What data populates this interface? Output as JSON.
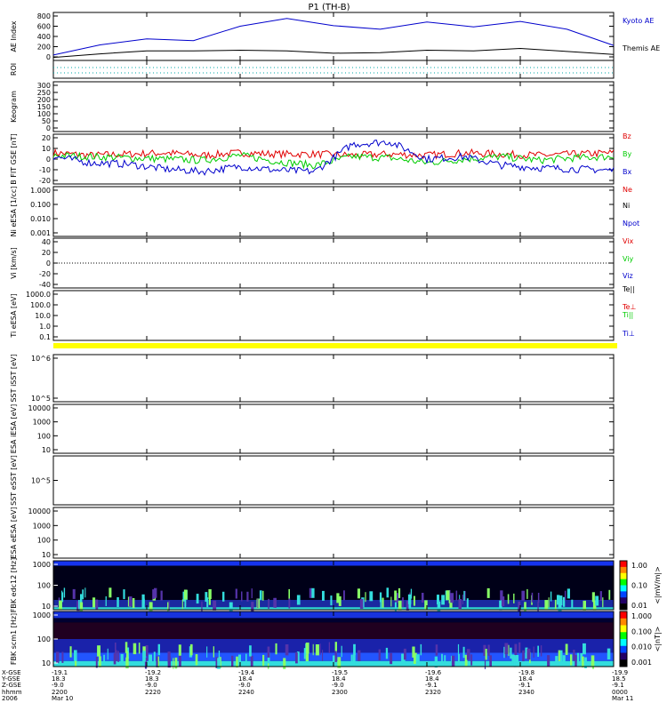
{
  "title": "P1 (TH-B)",
  "colors": {
    "red": "#e00000",
    "green": "#00cc00",
    "blue": "#0000cc",
    "black": "#000000",
    "yellow": "#ffff00",
    "roi": "#00aaaa"
  },
  "colorbars": {
    "fbk1": {
      "ticks": [
        "1.00",
        "0.10",
        "0.01"
      ],
      "label": "<|mV/m|>"
    },
    "fbk2": {
      "ticks": [
        "1.000",
        "0.100",
        "0.010",
        "0.001"
      ],
      "label": "<|nT|>"
    }
  },
  "time_axis": {
    "row_labels": [
      "X-GSE",
      "Y-GSE",
      "Z-GSE",
      "hhmm",
      "2006"
    ],
    "columns": [
      {
        "x": "-19.1",
        "y": "18.3",
        "z": "-9.0",
        "t": "2200",
        "date": "Mar 10"
      },
      {
        "x": "-19.2",
        "y": "18.3",
        "z": "-9.0",
        "t": "2220",
        "date": ""
      },
      {
        "x": "-19.4",
        "y": "18.4",
        "z": "-9.0",
        "t": "2240",
        "date": ""
      },
      {
        "x": "-19.5",
        "y": "18.4",
        "z": "-9.0",
        "t": "2300",
        "date": ""
      },
      {
        "x": "-19.6",
        "y": "18.4",
        "z": "-9.1",
        "t": "2320",
        "date": ""
      },
      {
        "x": "-19.8",
        "y": "18.4",
        "z": "-9.1",
        "t": "2340",
        "date": ""
      },
      {
        "x": "-19.9",
        "y": "18.5",
        "z": "-9.1",
        "t": "0000",
        "date": "Mar 11"
      }
    ]
  },
  "chart_data": [
    {
      "id": "ae",
      "type": "line",
      "ylabel": "AE Index",
      "yticks": [
        "800",
        "600",
        "400",
        "200",
        "0"
      ],
      "ylim": [
        0,
        800
      ],
      "x": [
        "2200",
        "2210",
        "2220",
        "2230",
        "2240",
        "2250",
        "2300",
        "2310",
        "2320",
        "2330",
        "2340",
        "2350",
        "0000"
      ],
      "series": [
        {
          "name": "Kyoto AE",
          "color": "blue",
          "values": [
            90,
            260,
            360,
            330,
            570,
            700,
            580,
            520,
            640,
            560,
            650,
            520,
            250
          ]
        },
        {
          "name": "Themis AE",
          "color": "black",
          "values": [
            50,
            110,
            160,
            160,
            170,
            160,
            120,
            130,
            170,
            160,
            200,
            150,
            100
          ]
        }
      ]
    },
    {
      "id": "roi",
      "type": "line",
      "ylabel": "ROI",
      "yticks": []
    },
    {
      "id": "keo",
      "type": "heatmap",
      "ylabel": "Keogram",
      "yticks": [
        "300",
        "250",
        "200",
        "150",
        "100",
        "50",
        "0"
      ],
      "ylim": [
        0,
        300
      ]
    },
    {
      "id": "bfit",
      "type": "line",
      "ylabel": "B FIT GSE [nT]",
      "yticks": [
        "20",
        "10",
        "0",
        "-10",
        "-20"
      ],
      "ylim": [
        -20,
        20
      ],
      "series": [
        {
          "name": "Bz",
          "color": "red",
          "values": [
            5,
            3,
            4,
            5,
            3,
            5,
            4,
            4,
            3,
            4,
            3,
            5,
            4,
            3,
            4,
            5
          ]
        },
        {
          "name": "By",
          "color": "green",
          "values": [
            3,
            2,
            1,
            0,
            -1,
            3,
            -2,
            -5,
            2,
            1,
            -3,
            0,
            2,
            -1,
            1,
            2
          ]
        },
        {
          "name": "Bx",
          "color": "blue",
          "values": [
            2,
            -3,
            -4,
            -8,
            -10,
            -6,
            -9,
            -10,
            12,
            14,
            0,
            2,
            -5,
            -7,
            -8,
            -9
          ]
        }
      ]
    },
    {
      "id": "ni",
      "type": "line",
      "ylabel": "Ni eESA [1/cc]",
      "yticks": [
        "1.000",
        "0.100",
        "0.010",
        "0.001"
      ],
      "series": [
        {
          "name": "Ne",
          "color": "red"
        },
        {
          "name": "Ni",
          "color": "black"
        },
        {
          "name": "Npot",
          "color": "blue"
        }
      ]
    },
    {
      "id": "vi",
      "type": "line",
      "ylabel": "Vi [km/s]",
      "yticks": [
        "40",
        "20",
        "0",
        "-20",
        "-40"
      ],
      "ylim": [
        -50,
        50
      ],
      "series": [
        {
          "name": "Vix",
          "color": "red"
        },
        {
          "name": "Viy",
          "color": "green"
        },
        {
          "name": "Viz",
          "color": "blue"
        }
      ]
    },
    {
      "id": "ti",
      "type": "line",
      "ylabel": "Ti eESA [eV]",
      "yticks": [
        "1000.0",
        "100.0",
        "10.0",
        "1.0",
        "0.1"
      ],
      "series": [
        {
          "name": "Te||",
          "color": "black"
        },
        {
          "name": "Te⊥",
          "color": "red"
        },
        {
          "name": "Ti||",
          "color": "green"
        },
        {
          "name": "Ti⊥",
          "color": "blue"
        }
      ]
    },
    {
      "id": "sst1",
      "type": "heatmap",
      "ylabel": "SST iSST [eV]",
      "yticks": [
        "10^6",
        "10^5"
      ]
    },
    {
      "id": "esa1",
      "type": "heatmap",
      "ylabel": "ESA iESA [eV]",
      "yticks": [
        "10000",
        "1000",
        "100",
        "10"
      ]
    },
    {
      "id": "sst2",
      "type": "heatmap",
      "ylabel": "SST eSST [eV]",
      "yticks": [
        "10^5"
      ]
    },
    {
      "id": "esa2",
      "type": "heatmap",
      "ylabel": "ESA eESA [eV]",
      "yticks": [
        "10000",
        "1000",
        "100",
        "10"
      ]
    },
    {
      "id": "fbk1",
      "type": "heatmap",
      "ylabel": "FBK edc12 [Hz]",
      "yticks": [
        "1000",
        "100",
        "10"
      ]
    },
    {
      "id": "fbk2",
      "type": "heatmap",
      "ylabel": "FBK scm1 [Hz]",
      "yticks": [
        "1000",
        "100",
        "10"
      ]
    }
  ]
}
